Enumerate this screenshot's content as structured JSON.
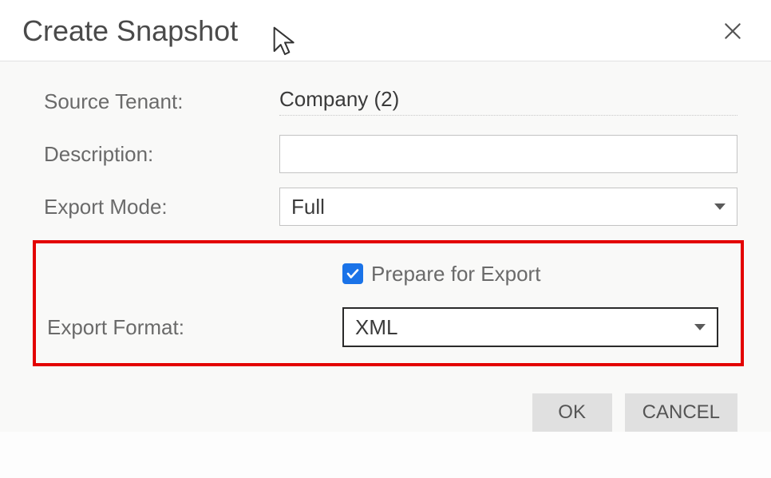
{
  "header": {
    "title": "Create Snapshot"
  },
  "fields": {
    "source_tenant_label": "Source Tenant:",
    "source_tenant_value": "Company (2)",
    "description_label": "Description:",
    "description_value": "",
    "export_mode_label": "Export Mode:",
    "export_mode_value": "Full",
    "prepare_for_export_label": "Prepare for Export",
    "prepare_for_export_checked": true,
    "export_format_label": "Export Format:",
    "export_format_value": "XML"
  },
  "buttons": {
    "ok": "OK",
    "cancel": "CANCEL"
  },
  "icons": {
    "close": "close-icon",
    "caret": "chevron-down-icon",
    "check": "check-icon",
    "cursor": "cursor-icon"
  }
}
